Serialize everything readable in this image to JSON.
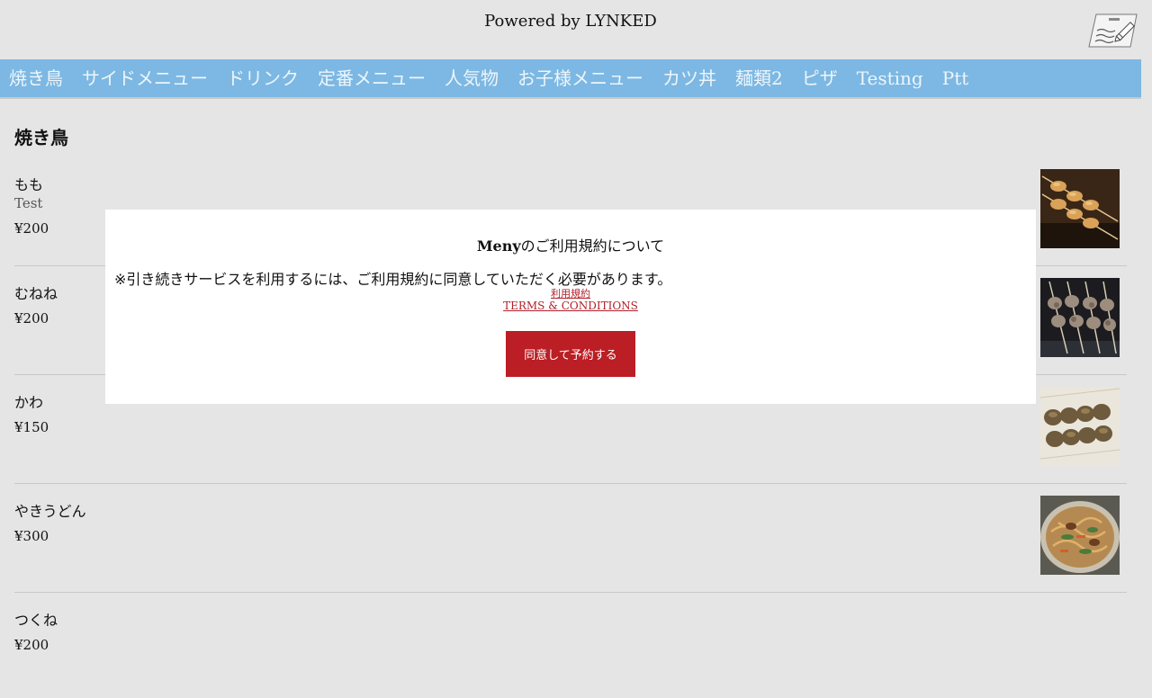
{
  "header": {
    "powered_by": "Powered by LYNKED",
    "logo_icon": "notepad-pencil-icon"
  },
  "nav": {
    "items": [
      "焼き鳥",
      "サイドメニュー",
      "ドリンク",
      "定番メニュー",
      "人気物",
      "お子様メニュー",
      "カツ丼",
      "麺類2",
      "ピザ",
      "Testing",
      "Ptt"
    ]
  },
  "section": {
    "title": "焼き鳥"
  },
  "menu": {
    "items": [
      {
        "name": "もも",
        "description": "Test",
        "price": "¥200",
        "image": "yakitori-momo-photo"
      },
      {
        "name": "むねね",
        "price": "¥200",
        "image": "yakitori-mune-photo"
      },
      {
        "name": "かわ",
        "price": "¥150",
        "image": "yakitori-kawa-photo"
      },
      {
        "name": "やきうどん",
        "price": "¥300",
        "image": "yaki-udon-photo"
      },
      {
        "name": "つくね",
        "price": "¥200"
      }
    ]
  },
  "modal": {
    "title_brand": "Meny",
    "title_rest": "のご利用規約について",
    "message": "※引き続きサービスを利用するには、ご利用規約に同意していただく必要があります。",
    "link_jp": "利用規約",
    "link_en": "TERMS & CONDITIONS",
    "agree_button": "同意して予約する"
  },
  "colors": {
    "nav_bg": "#7cb8e3",
    "accent": "#bb1e24",
    "background": "#e5e5e5"
  }
}
